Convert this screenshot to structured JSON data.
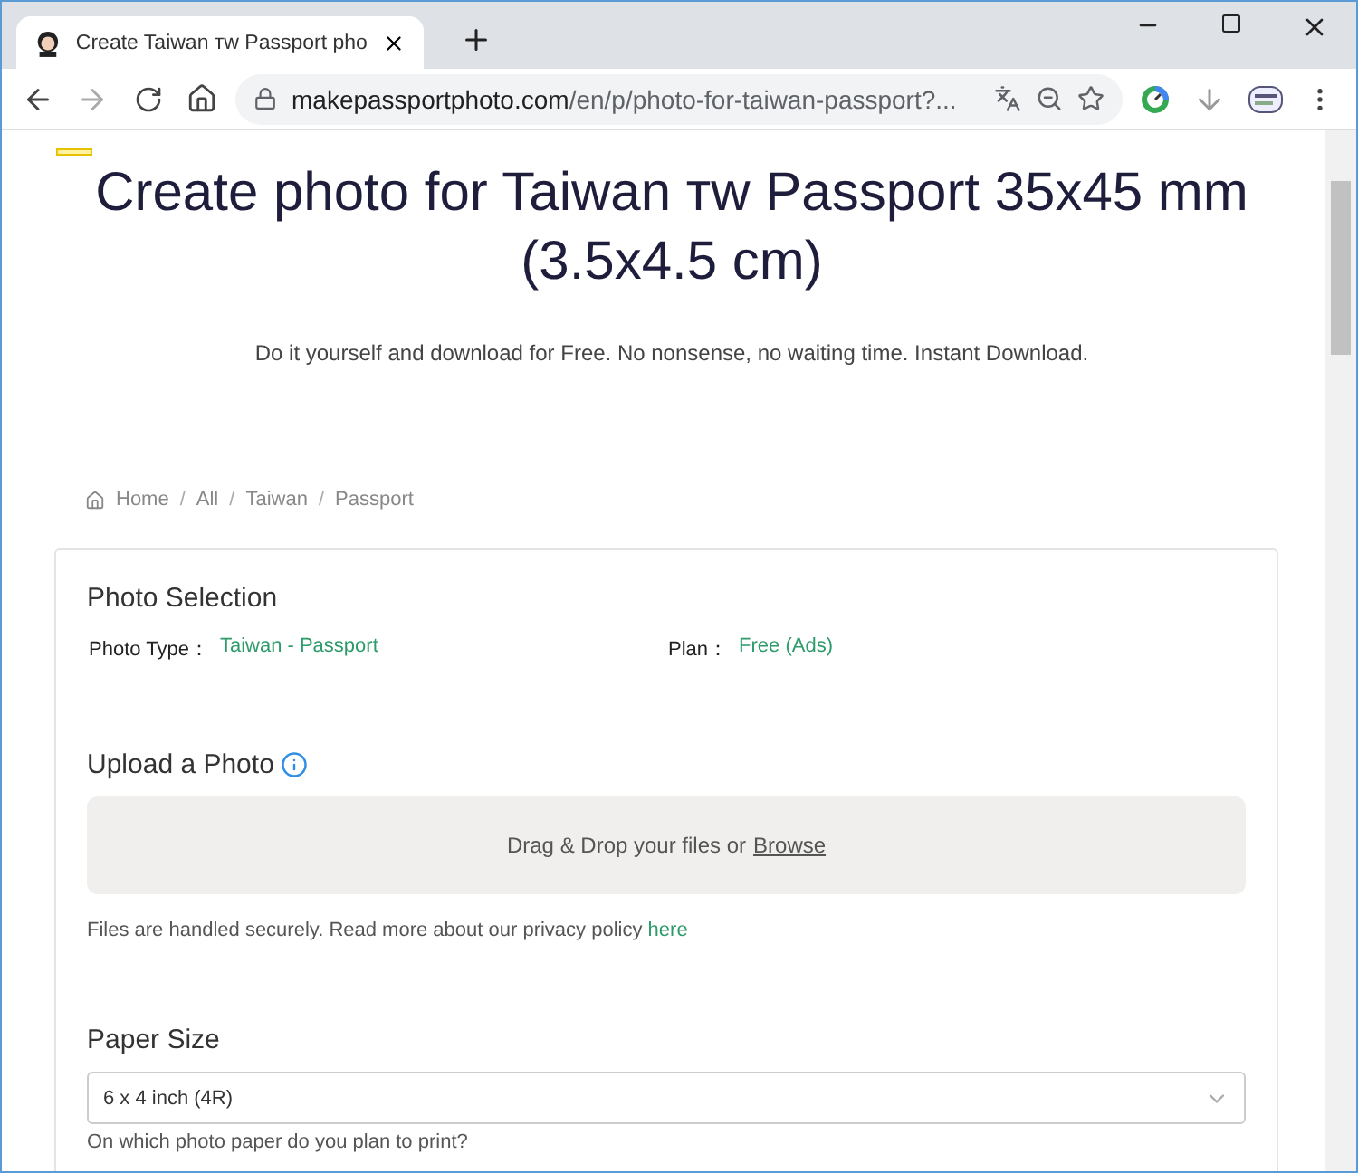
{
  "browser": {
    "tab_title": "Create Taiwan ᴛᴡ Passport pho",
    "url_host": "makepassportphoto.com",
    "url_path": "/en/p/photo-for-taiwan-passport?..."
  },
  "page": {
    "title_lines": [
      "Create photo for Taiwan ᴛᴡ Passport 35x45 mm",
      "(3.5x4.5 cm)"
    ],
    "subtitle": "Do it yourself and download for Free. No nonsense, no waiting time. Instant Download.",
    "breadcrumb": [
      "Home",
      "All",
      "Taiwan",
      "Passport"
    ],
    "breadcrumb_separator": "/",
    "photo_selection": {
      "heading": "Photo Selection",
      "fields": [
        {
          "label": "Photo Type：",
          "value": "Taiwan - Passport"
        },
        {
          "label": "Plan：",
          "value": "Free (Ads)"
        }
      ]
    },
    "upload": {
      "heading": "Upload a Photo",
      "drop_text": "Drag & Drop your files or",
      "browse_link": "Browse",
      "note": "Files are handled securely. Read more about our privacy policy",
      "note_link": "here"
    },
    "paper_size": {
      "heading": "Paper Size",
      "value": "6 x 4 inch (4R)",
      "hint": "On which photo paper do you plan to print?"
    }
  }
}
